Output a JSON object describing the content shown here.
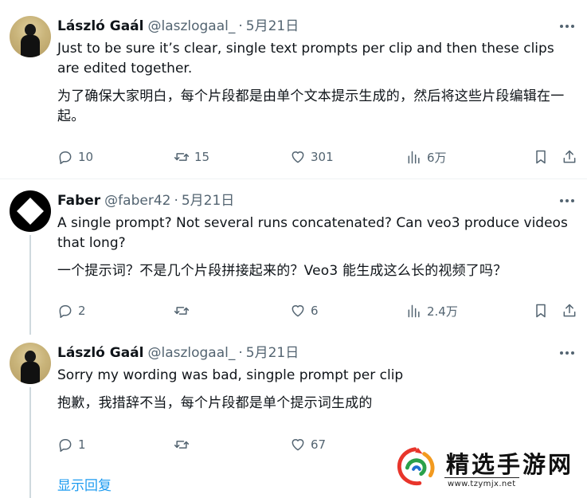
{
  "tweets": [
    {
      "name": "László Gaál",
      "handle": "@laszlogaal_",
      "separator": "·",
      "date": "5月21日",
      "text_en": "Just to be sure it’s clear, single text prompts per clip and then these clips are edited together.",
      "text_zh": "为了确保大家明白，每个片段都是由单个文本提示生成的，然后将这些片段编辑在一起。",
      "replies": "10",
      "retweets": "15",
      "likes": "301",
      "views": "6万"
    },
    {
      "name": "Faber",
      "handle": "@faber42",
      "separator": "·",
      "date": "5月21日",
      "text_en": "A single prompt? Not several runs concatenated? Can veo3 produce videos that long?",
      "text_zh": "一个提示词？不是几个片段拼接起来的？Veo3 能生成这么长的视频了吗？",
      "replies": "2",
      "retweets": "",
      "likes": "6",
      "views": "2.4万"
    },
    {
      "name": "László Gaál",
      "handle": "@laszlogaal_",
      "separator": "·",
      "date": "5月21日",
      "text_en": "Sorry my wording was bad, singple prompt per clip",
      "text_zh": "抱歉，我措辞不当，每个片段都是单个提示词生成的",
      "replies": "1",
      "retweets": "",
      "likes": "67",
      "views": ""
    }
  ],
  "show_replies_label": "显示回复",
  "watermark": {
    "text": "精选手游网",
    "url": "www.tzymjx.net"
  },
  "colors": {
    "link": "#1d9bf0",
    "secondary_text": "#536471",
    "divider": "#eff3f4",
    "thread_line": "#cfd9de"
  },
  "icons": [
    "more-icon",
    "reply-icon",
    "retweet-icon",
    "like-icon",
    "views-icon",
    "bookmark-icon",
    "share-icon"
  ]
}
